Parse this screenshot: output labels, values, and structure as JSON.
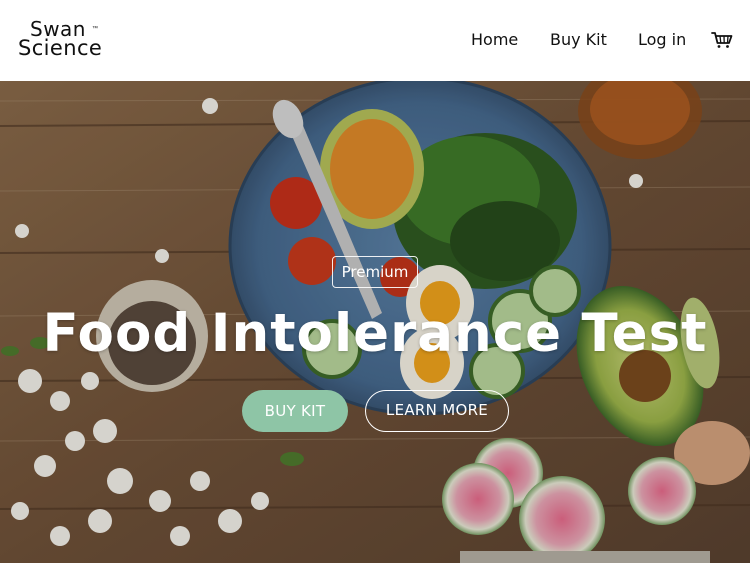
{
  "brand": {
    "name_line1": "Swan",
    "name_line2": "Science",
    "trademark": "™"
  },
  "nav": {
    "items": [
      {
        "label": "Home"
      },
      {
        "label": "Buy Kit"
      },
      {
        "label": "Log in"
      }
    ],
    "cart_icon": "cart-icon"
  },
  "hero": {
    "badge": "Premium",
    "title": "Food Intolerance Test",
    "primary_button": "BUY KIT",
    "secondary_button": "LEARN MORE",
    "background": "photo of a blue plate with salad, eggs, avocado and tomato on a wooden table"
  },
  "colors": {
    "accent": "#8ec5a6",
    "header_bg": "#ffffff",
    "text": "#111111"
  }
}
